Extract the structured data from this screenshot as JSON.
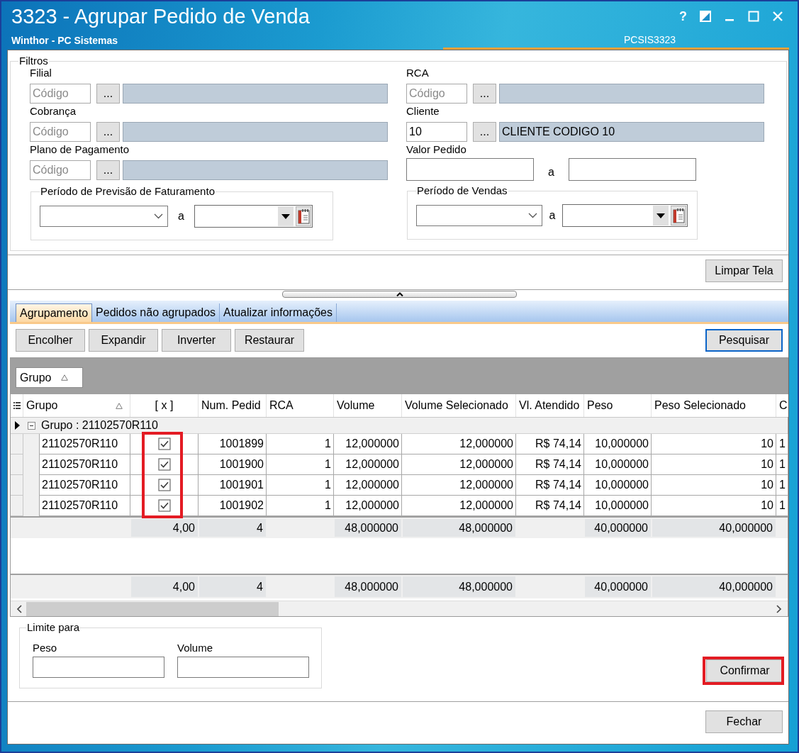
{
  "window": {
    "title": "3323 - Agrupar Pedido de Venda",
    "subtitle": "Winthor - PC Sistemas",
    "program_code": "PCSIS3323",
    "help_button": "?"
  },
  "filters": {
    "title": "Filtros",
    "left": {
      "lookups": [
        {
          "label": "Filial",
          "placeholder": "Código",
          "button": "..."
        },
        {
          "label": "Cobrança",
          "placeholder": "Código",
          "button": "..."
        },
        {
          "label": "Plano de Pagamento",
          "placeholder": "Código",
          "button": "..."
        }
      ],
      "period": {
        "title": "Período de Previsão de Faturamento",
        "separator": "a"
      }
    },
    "right": {
      "lookups": [
        {
          "label": "RCA",
          "placeholder": "Código",
          "button": "..."
        },
        {
          "label": "Cliente",
          "value": "10",
          "button": "...",
          "description": "CLIENTE CODIGO 10"
        }
      ],
      "range": {
        "label": "Valor Pedido",
        "separator": "a"
      },
      "period": {
        "title": "Período de Vendas",
        "separator": "a"
      }
    }
  },
  "clear_button": "Limpar Tela",
  "tabs": [
    {
      "label": "Agrupamento",
      "selected": true
    },
    {
      "label": "Pedidos não agrupados",
      "selected": false
    },
    {
      "label": "Atualizar informações",
      "selected": false
    }
  ],
  "toolbar": {
    "buttons": [
      "Encolher",
      "Expandir",
      "Inverter",
      "Restaurar"
    ],
    "search_button": {
      "label": "Pesquisar",
      "focused": true
    }
  },
  "grid": {
    "group_panel": [
      {
        "label": "Grupo",
        "sorted": true
      }
    ],
    "columns": [
      {
        "label": "Grupo",
        "kind": "text",
        "sorted": true
      },
      {
        "label": "[ x ]",
        "kind": "check",
        "highlighted": true,
        "group_summary": "4,00",
        "total": "4,00"
      },
      {
        "label": "Num. Pedid",
        "kind": "number",
        "group_summary": "4",
        "total": "4"
      },
      {
        "label": "RCA",
        "kind": "number"
      },
      {
        "label": "Volume",
        "kind": "number",
        "group_summary": "48,000000",
        "total": "48,000000"
      },
      {
        "label": "Volume Selecionado",
        "kind": "number",
        "group_summary": "48,000000",
        "total": "48,000000"
      },
      {
        "label": "Vl. Atendido",
        "kind": "number"
      },
      {
        "label": "Peso",
        "kind": "number",
        "group_summary": "40,000000",
        "total": "40,000000"
      },
      {
        "label": "Peso Selecionado",
        "kind": "number",
        "group_summary": "40,000000",
        "total": "40,000000"
      },
      {
        "label": "C",
        "kind": "number"
      }
    ],
    "group": {
      "label": "Grupo : 21102570R110",
      "expanded": true,
      "current": true
    },
    "rows": [
      {
        "checked": true,
        "values": [
          "21102570R110",
          "1001899",
          "1",
          "12,000000",
          "12,000000",
          "R$ 74,14",
          "10,000000",
          "10",
          "1"
        ]
      },
      {
        "checked": true,
        "values": [
          "21102570R110",
          "1001900",
          "1",
          "12,000000",
          "12,000000",
          "R$ 74,14",
          "10,000000",
          "10",
          "1"
        ]
      },
      {
        "checked": true,
        "values": [
          "21102570R110",
          "1001901",
          "1",
          "12,000000",
          "12,000000",
          "R$ 74,14",
          "10,000000",
          "10",
          "1"
        ]
      },
      {
        "checked": true,
        "values": [
          "21102570R110",
          "1001902",
          "1",
          "12,000000",
          "12,000000",
          "R$ 74,14",
          "10,000000",
          "10",
          "1"
        ]
      }
    ]
  },
  "limits": {
    "title": "Limite para",
    "fields": [
      {
        "label": "Peso"
      },
      {
        "label": "Volume"
      }
    ]
  },
  "confirm_button": {
    "label": "Confirmar",
    "highlighted": true
  },
  "close_button": "Fechar"
}
